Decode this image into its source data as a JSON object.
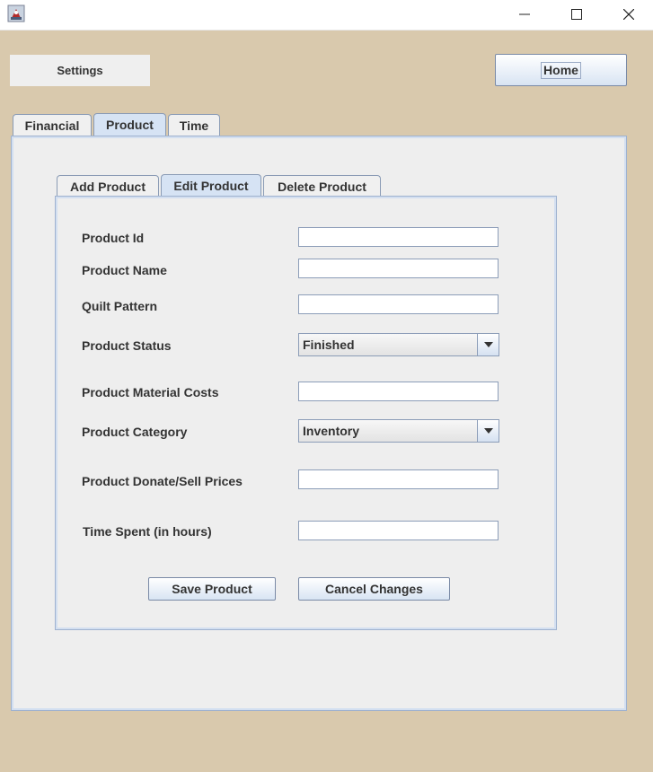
{
  "window": {
    "app_icon": "java-cup-icon",
    "controls": [
      "minimize-icon",
      "maximize-icon",
      "close-icon"
    ]
  },
  "header": {
    "settings_label": "Settings",
    "home_label": "Home"
  },
  "main_tabs": [
    {
      "label": "Financial",
      "selected": false
    },
    {
      "label": "Product",
      "selected": true
    },
    {
      "label": "Time",
      "selected": false
    }
  ],
  "product_tabs": [
    {
      "label": "Add Product",
      "selected": false
    },
    {
      "label": "Edit Product",
      "selected": true
    },
    {
      "label": "Delete Product",
      "selected": false
    }
  ],
  "form": {
    "product_id": {
      "label": "Product Id",
      "value": ""
    },
    "product_name": {
      "label": "Product Name",
      "value": ""
    },
    "quilt_pattern": {
      "label": "Quilt Pattern",
      "value": ""
    },
    "product_status": {
      "label": "Product Status",
      "value": "Finished"
    },
    "material_costs": {
      "label": "Product Material Costs",
      "value": ""
    },
    "product_category": {
      "label": "Product Category",
      "value": "Inventory"
    },
    "donate_sell_prices": {
      "label": "Product Donate/Sell Prices",
      "value": ""
    },
    "time_spent": {
      "label": "Time Spent (in hours)",
      "value": ""
    }
  },
  "actions": {
    "save_label": "Save Product",
    "cancel_label": "Cancel Changes"
  },
  "colors": {
    "background": "#d9c9ad",
    "panel": "#eeeeee",
    "selected_tab": "#d6e3f4",
    "border": "#9fb2cf"
  }
}
